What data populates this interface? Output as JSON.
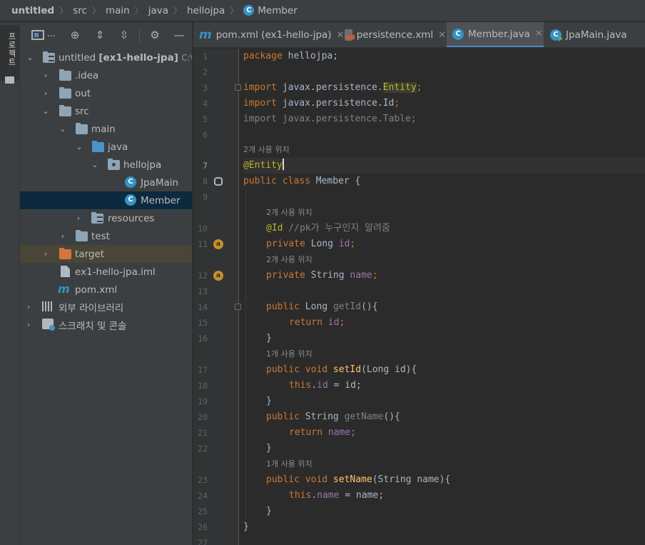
{
  "breadcrumb": {
    "items": [
      "untitled",
      "src",
      "main",
      "java",
      "hellojpa"
    ],
    "file": "Member",
    "file_icon": "C"
  },
  "sidebar": {
    "project_tab_label": "프로젝트",
    "toolbar_view_label": "..."
  },
  "tree": {
    "root": {
      "label": "untitled",
      "module": "[ex1-hello-jpa]",
      "path": "C:\\\\U"
    },
    "idea": ".idea",
    "out": "out",
    "src": "src",
    "main": "main",
    "java": "java",
    "hellojpa": "hellojpa",
    "jpamain": "JpaMain",
    "member": "Member",
    "resources": "resources",
    "test": "test",
    "target": "target",
    "iml": "ex1-hello-jpa.iml",
    "pom": "pom.xml",
    "ext_libs": "외부 라이브러리",
    "scratches": "스크래치 및 콘솔"
  },
  "tabs": [
    {
      "icon": "m",
      "label": "pom.xml (ex1-hello-jpa)"
    },
    {
      "icon": "xml",
      "label": "persistence.xml"
    },
    {
      "icon": "C",
      "label": "Member.java"
    },
    {
      "icon": "C",
      "label": "JpaMain.java"
    }
  ],
  "editor": {
    "line_numbers": [
      "1",
      "2",
      "3",
      "4",
      "5",
      "6",
      "7",
      "8",
      "9",
      "10",
      "11",
      "12",
      "13",
      "14",
      "15",
      "16",
      "17",
      "18",
      "19",
      "20",
      "21",
      "22",
      "23",
      "24",
      "25",
      "26",
      "27"
    ],
    "hints": {
      "h1": "2개 사용 위치",
      "h2": "2개 사용 위치",
      "h3": "2개 사용 위치",
      "h4": "1개 사용 위치",
      "h5": "1개 사용 위치"
    },
    "code": {
      "l1_kw": "package",
      "l1_rest": " hellojpa;",
      "l3_kw": "import",
      "l3_pkg": " javax.persistence.",
      "l3_cls": "Entity",
      "l3_end": ";",
      "l4_kw": "import",
      "l4_pkg": " javax.persistence.",
      "l4_cls": "Id",
      "l4_end": ";",
      "l5_text": "import javax.persistence.Table;",
      "l7_ann": "@Entity",
      "l8_kw": "public class",
      "l8_rest": " Member {",
      "l10_ann": "@Id",
      "l10_cmt": " //pk가 누구인지 알려줌",
      "l11_kw": "private",
      "l11_type": " Long ",
      "l11_fld": "id",
      "l11_end": ";",
      "l12_kw": "private",
      "l12_type": " String ",
      "l12_fld": "name",
      "l12_end": ";",
      "l14_kw": "public",
      "l14_type": " Long ",
      "l14_mth": "getId",
      "l14_end": "(){",
      "l15_kw": "return",
      "l15_fld": " id",
      "l15_end": ";",
      "l16": "}",
      "l17_kw": "public void",
      "l17_mth": " setId",
      "l17_end": "(Long id){",
      "l18_kw": "this",
      "l18_dot": ".",
      "l18_fld": "id",
      "l18_end": " = id;",
      "l19": "}",
      "l20_kw": "public",
      "l20_type": " String ",
      "l20_mth": "getName",
      "l20_end": "(){",
      "l21_kw": "return",
      "l21_fld": " name",
      "l21_end": ";",
      "l22": "}",
      "l23_kw": "public void",
      "l23_mth": " setName",
      "l23_end": "(String name){",
      "l24_kw": "this",
      "l24_dot": ".",
      "l24_fld": "name",
      "l24_end": " = name;",
      "l25": "}",
      "l26": "}"
    }
  }
}
